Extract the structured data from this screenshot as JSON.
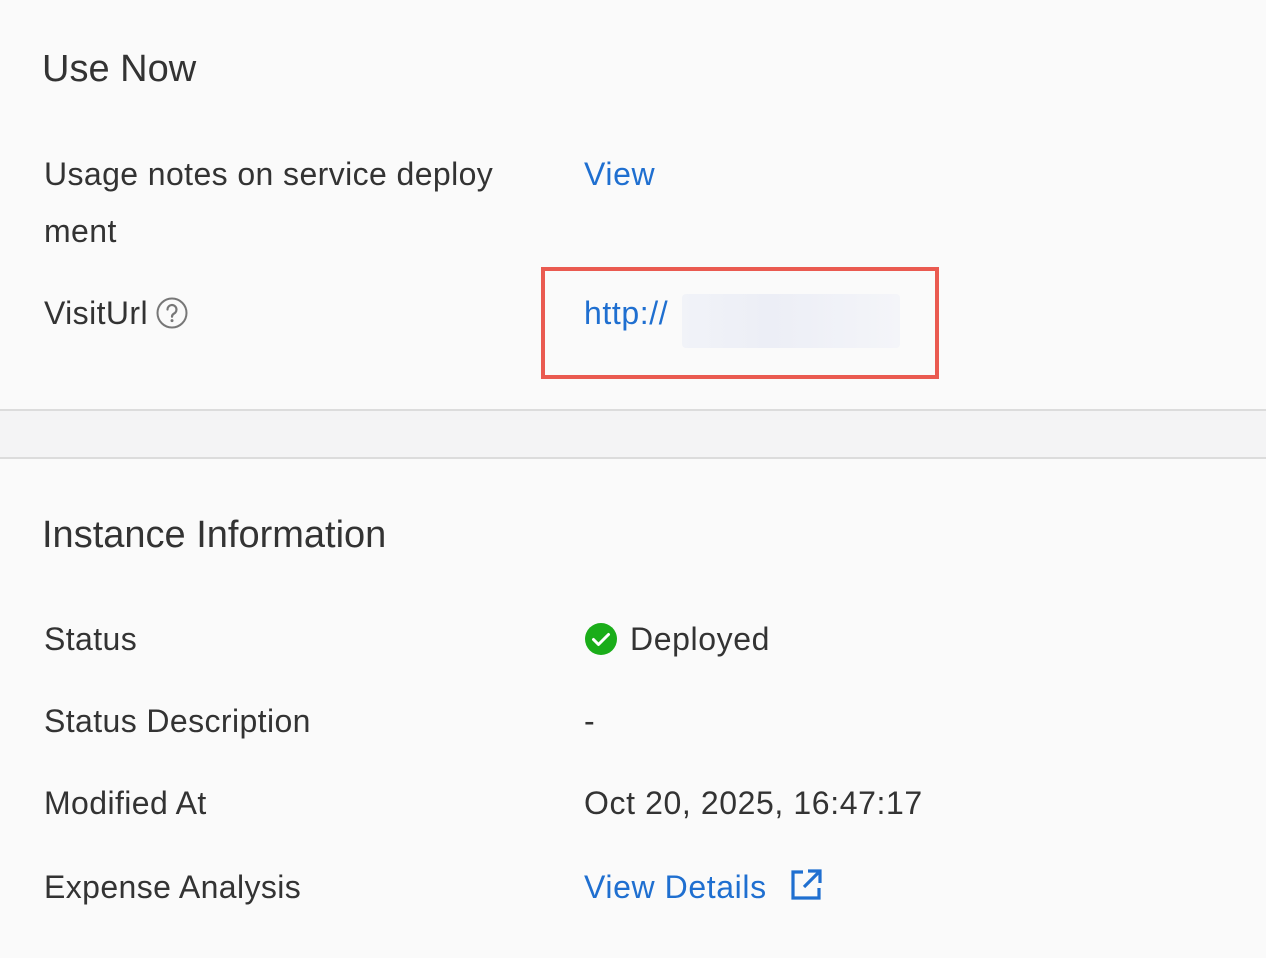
{
  "use_now": {
    "title": "Use Now",
    "usage_notes_label_line1": "Usage notes on service deploy",
    "usage_notes_label_line2": "ment",
    "usage_notes_link": "View",
    "visit_url_label": "VisitUrl",
    "visit_url_value": "http://"
  },
  "instance_info": {
    "title": "Instance Information",
    "rows": [
      {
        "label": "Status",
        "value": "Deployed"
      },
      {
        "label": "Status Description",
        "value": "-"
      },
      {
        "label": "Modified At",
        "value": "Oct 20, 2025, 16:47:17"
      },
      {
        "label": "Expense Analysis",
        "value": "View Details"
      }
    ]
  },
  "colors": {
    "link": "#1f6fd0",
    "success": "#1aad19",
    "highlight_border": "#ea5a50",
    "divider": "#dcdcdc"
  },
  "icons": {
    "help": "question-circle-icon",
    "status": "check-circle-icon",
    "external": "external-link-icon"
  }
}
